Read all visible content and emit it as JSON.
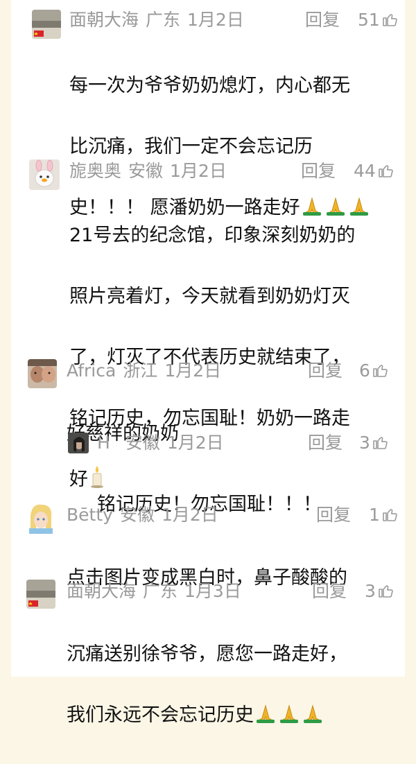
{
  "comments": [
    {
      "user": "面朝大海",
      "region": "广东",
      "date": "1月2日",
      "reply_label": "回复",
      "likes": "51",
      "text_lines": [
        "每一次为爷爷奶奶熄灯，内心都无",
        "比沉痛，我们一定不会忘记历",
        "史！！！ 愿潘奶奶一路走好"
      ],
      "emoji": "pray-icon-x3"
    },
    {
      "user": "旎奥奥",
      "region": "安徽",
      "date": "1月2日",
      "reply_label": "回复",
      "likes": "44",
      "text_lines": [
        "21号去的纪念馆，印象深刻奶奶的",
        "照片亮着灯，今天就看到奶奶灯灭",
        "了，灯灭了不代表历史就结束了，",
        "铭记历史，勿忘国耻！奶奶一路走",
        "好"
      ],
      "emoji": "candle-icon"
    },
    {
      "user": "Africa",
      "region": "浙江",
      "date": "1月2日",
      "reply_label": "回复",
      "likes": "6",
      "text_lines": [
        "好慈祥的奶奶"
      ]
    },
    {
      "user": "H",
      "region": "安徽",
      "date": "1月2日",
      "reply_label": "回复",
      "likes": "3",
      "text_lines": [
        "铭记历史！勿忘国耻！！！"
      ]
    },
    {
      "user": "Bētty",
      "region": "安徽",
      "date": "1月2日",
      "reply_label": "回复",
      "likes": "1",
      "text_lines": [
        "点击图片变成黑白时，鼻子酸酸的"
      ]
    },
    {
      "user": "面朝大海",
      "region": "广东",
      "date": "1月3日",
      "reply_label": "回复",
      "likes": "3",
      "text_lines": [
        "沉痛送别徐爷爷，愿您一路走好，",
        "我们永远不会忘记历史"
      ],
      "emoji": "pray-icon-x3"
    }
  ]
}
